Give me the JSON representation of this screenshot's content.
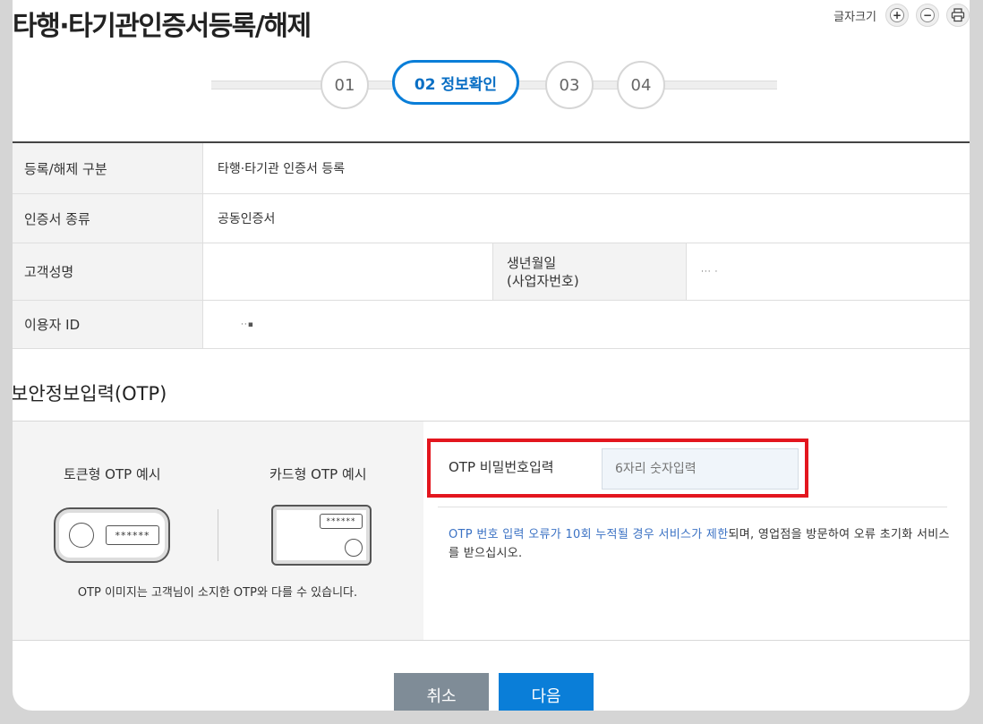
{
  "page_title": "타행·타기관인증서등록/해제",
  "font_size_control": {
    "label": "글자크기",
    "increase": "+",
    "decrease": "−",
    "print_icon": "printer-icon"
  },
  "steps": [
    {
      "label": "01",
      "active": false
    },
    {
      "label": "02 정보확인",
      "active": true
    },
    {
      "label": "03",
      "active": false
    },
    {
      "label": "04",
      "active": false
    }
  ],
  "info": {
    "reg_type": {
      "label": "등록/해제 구분",
      "value": "타행·타기관 인증서 등록"
    },
    "cert_type": {
      "label": "인증서 종류",
      "value": "공동인증서"
    },
    "customer_name": {
      "label": "고객성명",
      "value": ""
    },
    "birth": {
      "label_line1": "생년월일",
      "label_line2": "(사업자번호)",
      "value": "··· ·"
    },
    "user_id": {
      "label": "이용자 ID",
      "value": "··▪"
    }
  },
  "otp": {
    "section_title": "보안정보입력(OTP)",
    "token_example_label": "토큰형 OTP 예시",
    "card_example_label": "카드형 OTP 예시",
    "token_screen": "******",
    "card_screen": "******",
    "image_note": "OTP 이미지는 고객님이 소지한 OTP와 다를 수 있습니다.",
    "input_label": "OTP 비밀번호입력",
    "input_placeholder": "6자리 숫자입력",
    "input_value": "",
    "warning_blue": "OTP 번호 입력 오류가 10회 누적될 경우 서비스가 제한",
    "warning_rest": "되며, 영업점을 방문하여 오류 초기화 서비스를 받으십시오."
  },
  "buttons": {
    "cancel": "취소",
    "next": "다음"
  },
  "colors": {
    "accent": "#0a7ed8",
    "highlight": "#e3161e",
    "cancel": "#7f8c97"
  }
}
